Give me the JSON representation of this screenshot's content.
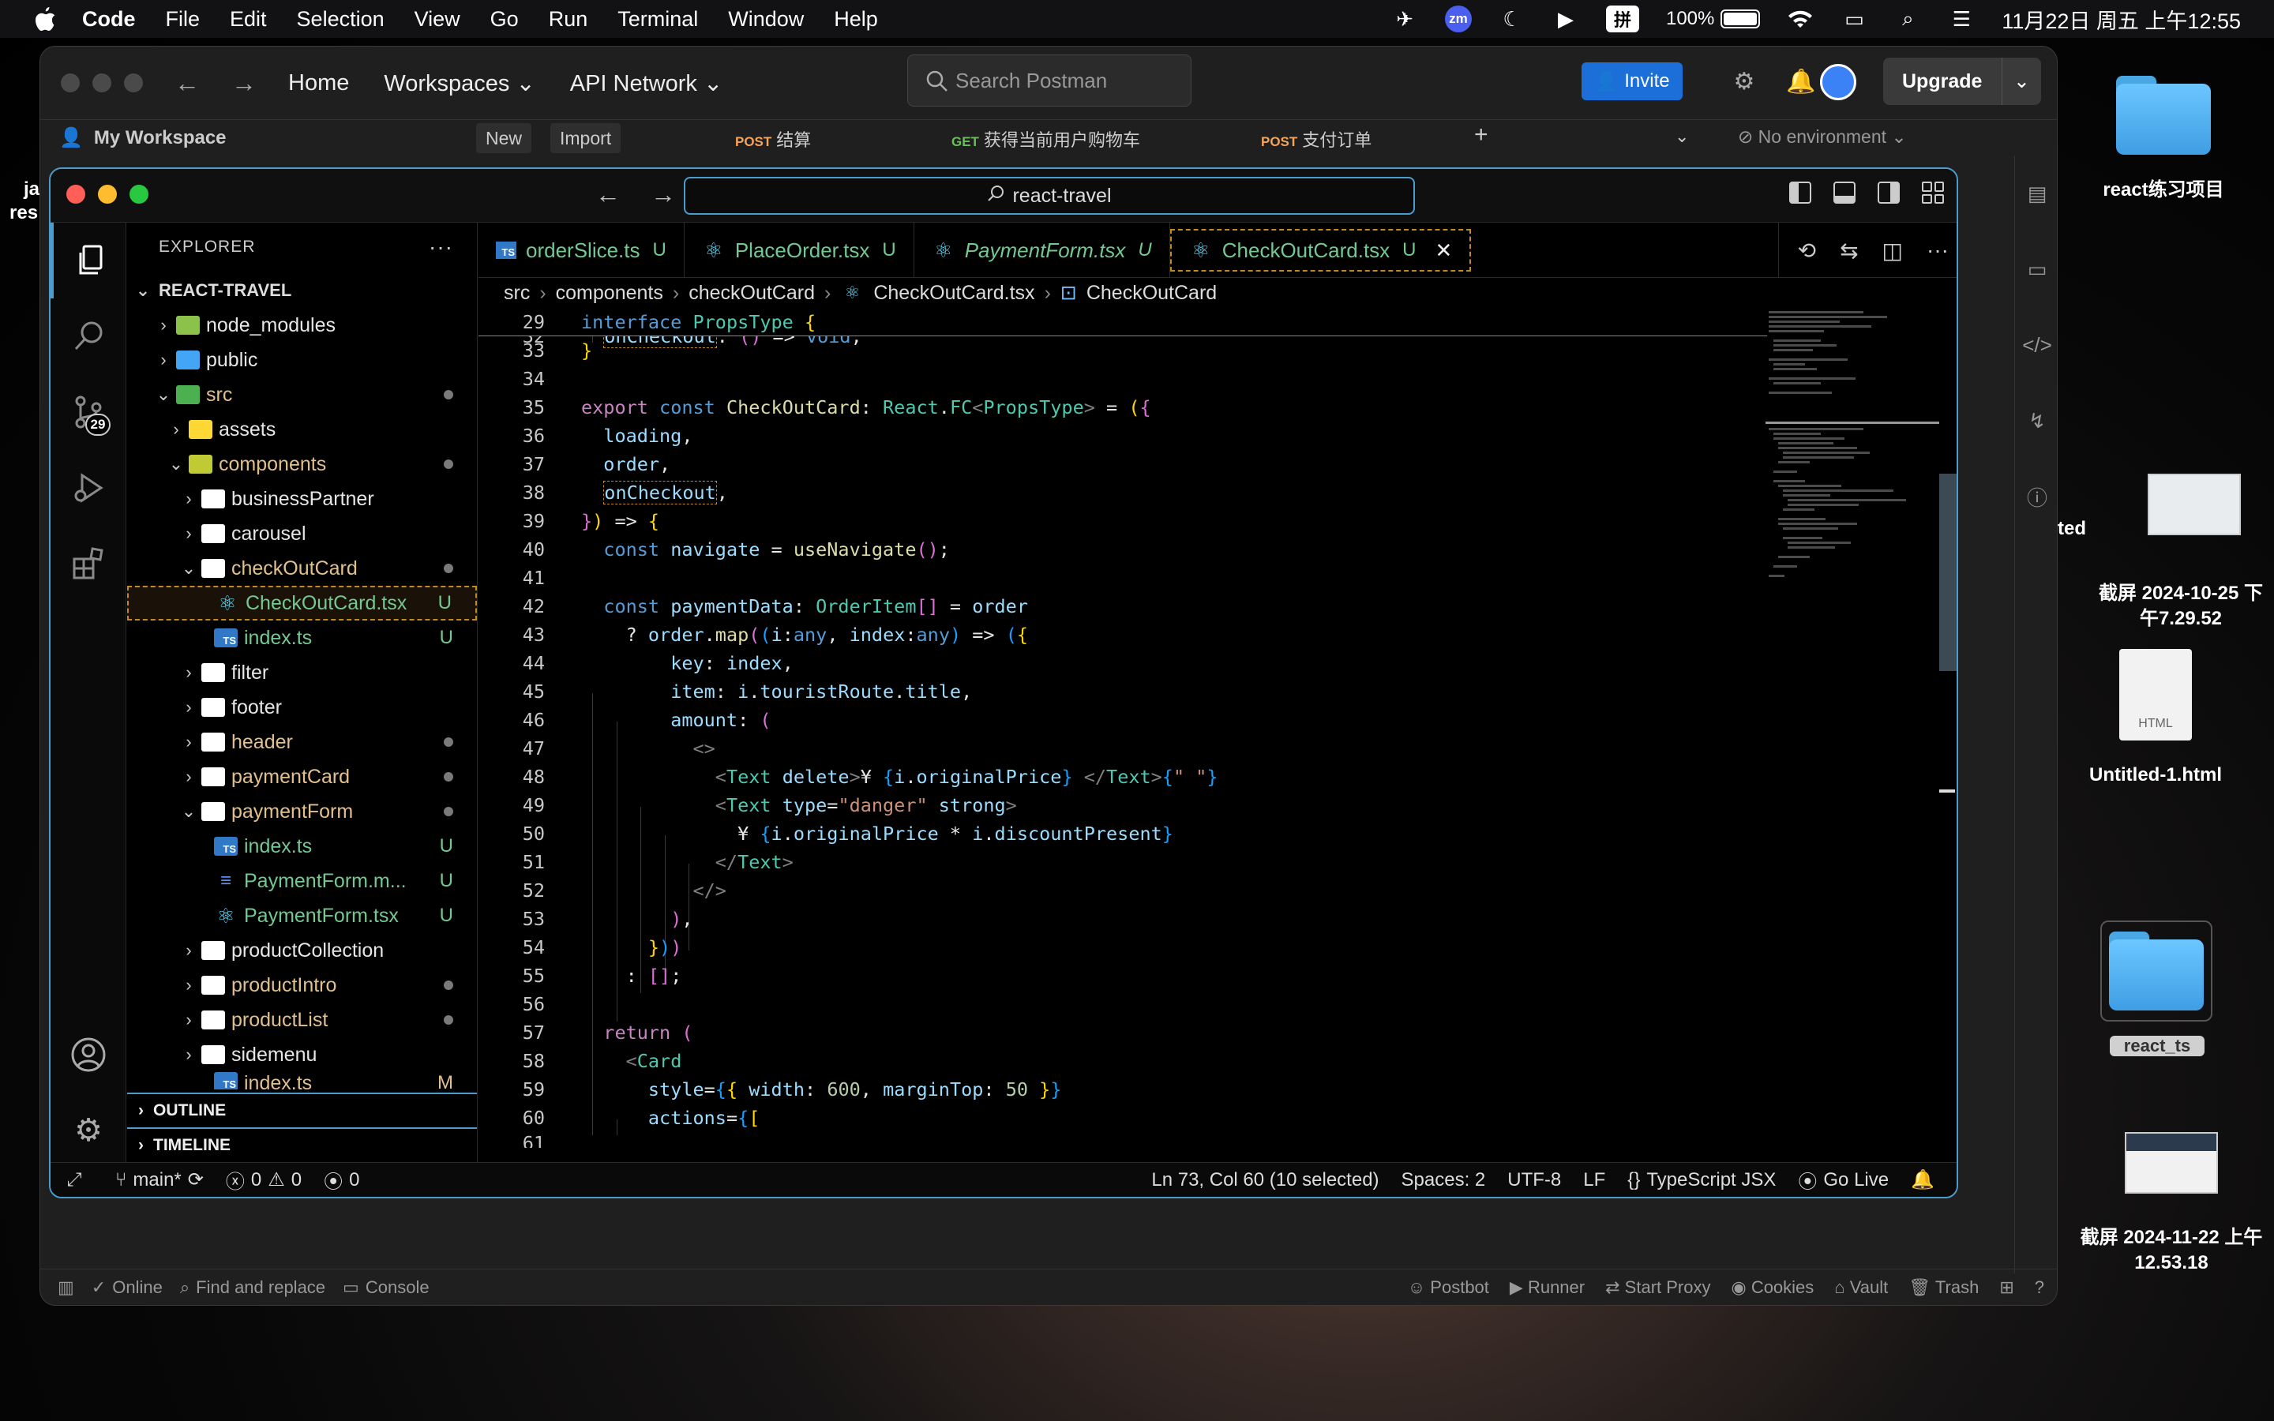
{
  "menubar": {
    "app": "Code",
    "menus": [
      "File",
      "Edit",
      "Selection",
      "View",
      "Go",
      "Run",
      "Terminal",
      "Window",
      "Help"
    ],
    "zm": "zm",
    "ime": "拼",
    "battery": "100%",
    "datetime": "11月22日 周五 上午12:55"
  },
  "desktop": {
    "items": [
      "react练习项目",
      "截屏 2024-10-25 下午7.29.52",
      "Untitled-1.html",
      "react_ts",
      "截屏 2024-11-22 上午12.53.18"
    ],
    "partial": [
      "ted",
      "ja",
      "res"
    ],
    "html_label": "HTML"
  },
  "postman": {
    "nav": [
      "Home",
      "Workspaces",
      "API Network"
    ],
    "search_placeholder": "Search Postman",
    "invite": "Invite",
    "upgrade": "Upgrade",
    "workspace": "My Workspace",
    "new_btn": "New",
    "import_btn": "Import",
    "tabs": [
      {
        "method": "POST",
        "name": "结算"
      },
      {
        "method": "GET",
        "name": "获得当前用户购物车"
      },
      {
        "method": "POST",
        "name": "支付订单"
      }
    ],
    "environment": "No environment",
    "footer_left": [
      "Online",
      "Find and replace",
      "Console"
    ],
    "footer_right": [
      "Postbot",
      "Runner",
      "Start Proxy",
      "Cookies",
      "Vault",
      "Trash"
    ]
  },
  "vscode": {
    "command_center": "react-travel",
    "explorer_title": "EXPLORER",
    "project": "REACT-TRAVEL",
    "scm_badge": "29",
    "tree": [
      {
        "name": "node_modules"
      },
      {
        "name": "public"
      },
      {
        "name": "src"
      },
      {
        "name": "assets"
      },
      {
        "name": "components"
      },
      {
        "name": "businessPartner"
      },
      {
        "name": "carousel"
      },
      {
        "name": "checkOutCard"
      },
      {
        "name": "CheckOutCard.tsx",
        "status": "U"
      },
      {
        "name": "index.ts",
        "status": "U"
      },
      {
        "name": "filter"
      },
      {
        "name": "footer"
      },
      {
        "name": "header"
      },
      {
        "name": "paymentCard"
      },
      {
        "name": "paymentForm"
      },
      {
        "name": "index.ts",
        "status": "U"
      },
      {
        "name": "PaymentForm.m...",
        "status": "U"
      },
      {
        "name": "PaymentForm.tsx",
        "status": "U"
      },
      {
        "name": "productCollection"
      },
      {
        "name": "productIntro"
      },
      {
        "name": "productList"
      },
      {
        "name": "sidemenu"
      },
      {
        "name": "index.ts",
        "status": "M"
      }
    ],
    "outline": "OUTLINE",
    "timeline": "TIMELINE",
    "tabs": [
      {
        "name": "orderSlice.ts",
        "status": "U"
      },
      {
        "name": "PlaceOrder.tsx",
        "status": "U"
      },
      {
        "name": "PaymentForm.tsx",
        "status": "U"
      },
      {
        "name": "CheckOutCard.tsx",
        "status": "U"
      }
    ],
    "breadcrumb": [
      "src",
      "components",
      "checkOutCard",
      "CheckOutCard.tsx",
      "CheckOutCard"
    ],
    "line_numbers": [
      "29",
      "32",
      "33",
      "34",
      "35",
      "36",
      "37",
      "38",
      "39",
      "40",
      "41",
      "42",
      "43",
      "44",
      "45",
      "46",
      "47",
      "48",
      "49",
      "50",
      "51",
      "52",
      "53",
      "54",
      "55",
      "56",
      "57",
      "58",
      "59",
      "60",
      "61"
    ],
    "status": {
      "branch": "main*",
      "errors": "0",
      "warnings": "0",
      "ports": "0",
      "cursor": "Ln 73, Col 60 (10 selected)",
      "spaces": "Spaces: 2",
      "encoding": "UTF-8",
      "eol": "LF",
      "language": "TypeScript JSX",
      "golive": "Go Live"
    }
  }
}
